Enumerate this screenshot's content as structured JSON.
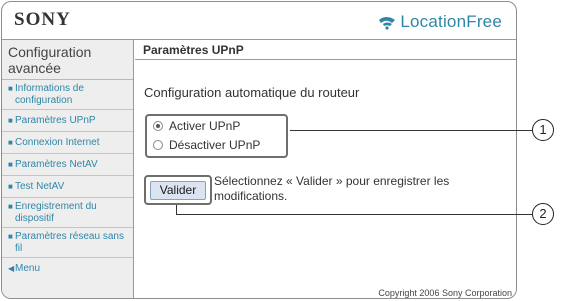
{
  "header": {
    "brand": "SONY",
    "product": "LocationFree"
  },
  "sidebar": {
    "title": "Configuration avancée",
    "items": [
      {
        "label": "Informations de configuration"
      },
      {
        "label": "Paramètres UPnP"
      },
      {
        "label": "Connexion Internet"
      },
      {
        "label": "Paramètres NetAV"
      },
      {
        "label": "Test NetAV"
      },
      {
        "label": "Enregistrement du dispositif"
      },
      {
        "label": "Paramètres réseau sans fil"
      }
    ],
    "menu_label": "Menu"
  },
  "content": {
    "title": "Paramètres UPnP",
    "section_label": "Configuration automatique du routeur",
    "radios": [
      {
        "label": "Activer UPnP",
        "selected": true
      },
      {
        "label": "Désactiver UPnP",
        "selected": false
      }
    ],
    "submit_label": "Valider",
    "hint": "Sélectionnez « Valider » pour enregistrer les modifications.",
    "copyright": "Copyright 2006 Sony Corporation"
  },
  "callouts": [
    "1",
    "2"
  ],
  "colors": {
    "accent": "#2f86a6",
    "sidebar_bg": "#eeeeee",
    "button_bg": "#dbe4f0"
  }
}
